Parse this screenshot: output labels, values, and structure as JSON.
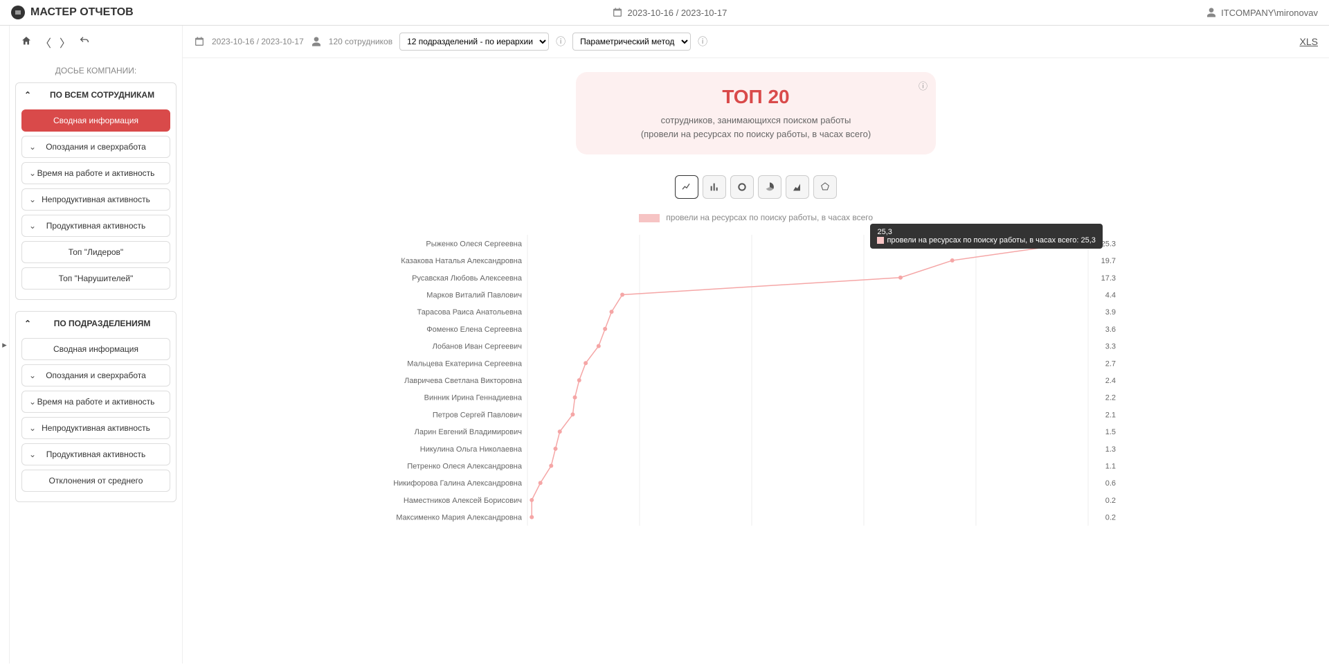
{
  "header": {
    "app_title": "МАСТЕР ОТЧЕТОВ",
    "date_range": "2023-10-16 / 2023-10-17",
    "user": "ITCOMPANY\\mironovav"
  },
  "main_toolbar": {
    "date_range": "2023-10-16 / 2023-10-17",
    "employee_count": "120 сотрудников",
    "department_select": "12 подразделений - по иерархии",
    "method_select": "Параметрический метод",
    "export_label": "XLS"
  },
  "sidebar": {
    "dossier_title": "ДОСЬЕ КОМПАНИИ:",
    "group1": {
      "title": "ПО ВСЕМ СОТРУДНИКАМ",
      "items": [
        {
          "label": "Сводная информация",
          "chev": false,
          "active": true
        },
        {
          "label": "Опоздания и сверхработа",
          "chev": true
        },
        {
          "label": "Время на работе и активность",
          "chev": true
        },
        {
          "label": "Непродуктивная активность",
          "chev": true
        },
        {
          "label": "Продуктивная активность",
          "chev": true
        },
        {
          "label": "Топ \"Лидеров\"",
          "chev": false
        },
        {
          "label": "Топ \"Нарушителей\"",
          "chev": false
        }
      ]
    },
    "group2": {
      "title": "ПО ПОДРАЗДЕЛЕНИЯМ",
      "items": [
        {
          "label": "Сводная информация",
          "chev": false
        },
        {
          "label": "Опоздания и сверхработа",
          "chev": true
        },
        {
          "label": "Время на работе и активность",
          "chev": true
        },
        {
          "label": "Непродуктивная активность",
          "chev": true
        },
        {
          "label": "Продуктивная активность",
          "chev": true
        },
        {
          "label": "Отклонения от среднего",
          "chev": false
        }
      ]
    }
  },
  "top_card": {
    "title": "ТОП 20",
    "line1": "сотрудников, занимающихся поиском работы",
    "line2": "(провели на ресурсах по поиску работы, в часах всего)"
  },
  "legend_label": "провели на ресурсах по поиску работы, в часах всего",
  "tooltip": {
    "value": "25,3",
    "series": "провели на ресурсах по поиску работы, в часах всего: 25,3"
  },
  "chart_data": {
    "type": "line",
    "title": "ТОП 20",
    "ylabel": "",
    "xlabel": "провели на ресурсах по поиску работы, в часах всего",
    "categories": [
      "Рыженко Олеся Сергеевна",
      "Казакова Наталья Александровна",
      "Русавская Любовь Алексеевна",
      "Марков Виталий Павлович",
      "Тарасова Раиса Анатольевна",
      "Фоменко Елена Сергеевна",
      "Лобанов Иван Сергеевич",
      "Мальцева Екатерина Сергеевна",
      "Лавричева Светлана Викторовна",
      "Винник Ирина Геннадиевна",
      "Петров Сергей Павлович",
      "Ларин Евгений Владимирович",
      "Никулина Ольга Николаевна",
      "Петренко Олеся Александровна",
      "Никифорова Галина Александровна",
      "Наместников Алексей Борисович",
      "Максименко Мария Александровна"
    ],
    "values": [
      25.3,
      19.7,
      17.3,
      4.4,
      3.9,
      3.6,
      3.3,
      2.7,
      2.4,
      2.2,
      2.1,
      1.5,
      1.3,
      1.1,
      0.6,
      0.2,
      0.2
    ],
    "value_labels": [
      "25.3",
      "19.7",
      "17.3",
      "4.4",
      "3.9",
      "3.6",
      "3.3",
      "2.7",
      "2.4",
      "2.2",
      "2.1",
      "1.5",
      "1.3",
      "1.1",
      "0.6",
      "0.2",
      "0.2"
    ],
    "xlim": [
      0,
      26
    ],
    "highlight_index": 0
  }
}
